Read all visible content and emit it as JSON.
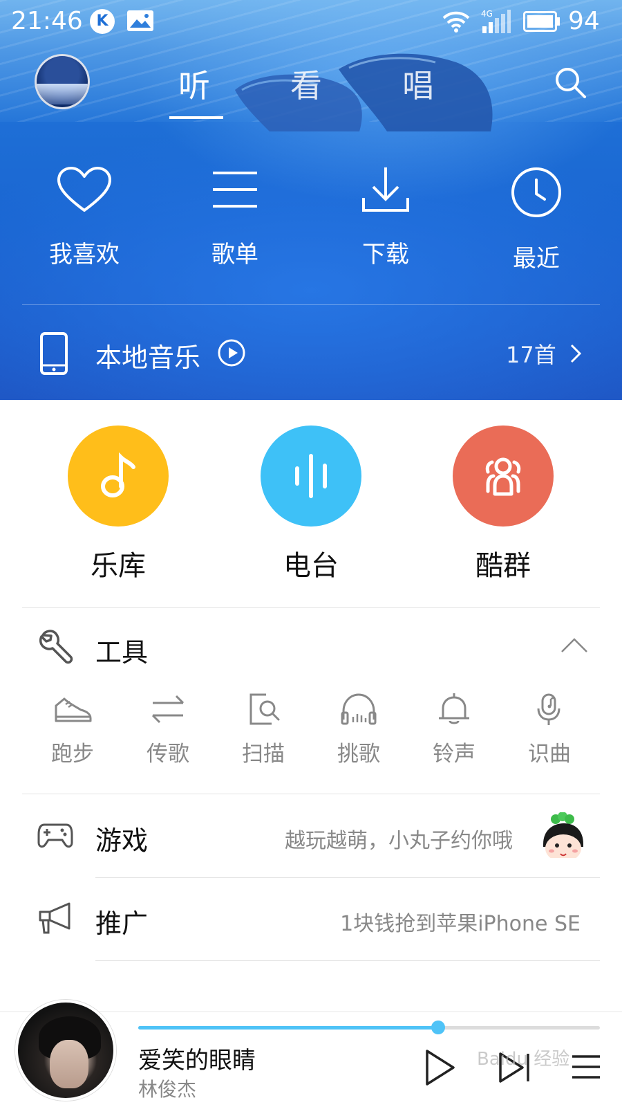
{
  "status_bar": {
    "time": "21:46",
    "k_badge": "K",
    "network": "4G",
    "battery": "94"
  },
  "top_nav": {
    "tabs": [
      {
        "label": "听",
        "active": true
      },
      {
        "label": "看",
        "active": false
      },
      {
        "label": "唱",
        "active": false
      }
    ],
    "search_icon": "search-icon"
  },
  "quick_actions": [
    {
      "label": "我喜欢",
      "icon": "heart-icon"
    },
    {
      "label": "歌单",
      "icon": "playlist-icon"
    },
    {
      "label": "下载",
      "icon": "download-icon"
    },
    {
      "label": "最近",
      "icon": "clock-icon"
    }
  ],
  "local_music": {
    "title": "本地音乐",
    "count": "17首"
  },
  "features": [
    {
      "label": "乐库",
      "color": "#FFBE1A",
      "icon": "music-note-icon"
    },
    {
      "label": "电台",
      "color": "#3EC1F7",
      "icon": "sound-wave-icon"
    },
    {
      "label": "酷群",
      "color": "#EA6C57",
      "icon": "group-icon"
    }
  ],
  "tools": {
    "title": "工具",
    "items": [
      {
        "label": "跑步",
        "icon": "sneaker-icon"
      },
      {
        "label": "传歌",
        "icon": "transfer-icon"
      },
      {
        "label": "扫描",
        "icon": "scan-icon"
      },
      {
        "label": "挑歌",
        "icon": "headphones-icon"
      },
      {
        "label": "铃声",
        "icon": "bell-icon"
      },
      {
        "label": "识曲",
        "icon": "mic-music-icon"
      }
    ]
  },
  "rows": [
    {
      "title": "游戏",
      "desc": "越玩越萌，小丸子约你哦",
      "icon": "gamepad-icon"
    },
    {
      "title": "推广",
      "desc": "1块钱抢到苹果iPhone SE",
      "icon": "megaphone-icon"
    }
  ],
  "player": {
    "song": "爱笑的眼睛",
    "artist": "林俊杰",
    "progress": 0.65
  },
  "watermark": "Baidu 经验",
  "colors": {
    "accent": "#4FC3F7",
    "hero_blue": "#1E6FD6"
  }
}
